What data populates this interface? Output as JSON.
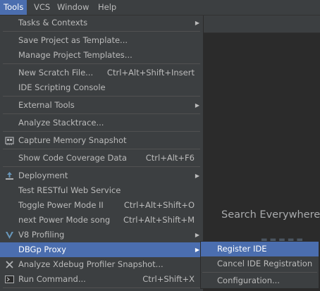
{
  "menubar": [
    {
      "key": "tools",
      "label": "Tools",
      "active": true
    },
    {
      "key": "vcs",
      "label": "VCS",
      "active": false
    },
    {
      "key": "window",
      "label": "Window",
      "active": false
    },
    {
      "key": "help",
      "label": "Help",
      "active": false
    }
  ],
  "tools_menu": {
    "tasks_contexts": {
      "label": "Tasks & Contexts"
    },
    "save_project_as_template": {
      "label": "Save Project as Template..."
    },
    "manage_project_templates": {
      "label": "Manage Project Templates..."
    },
    "new_scratch_file": {
      "label": "New Scratch File...",
      "shortcut": "Ctrl+Alt+Shift+Insert"
    },
    "ide_scripting_console": {
      "label": "IDE Scripting Console"
    },
    "external_tools": {
      "label": "External Tools"
    },
    "analyze_stacktrace": {
      "label": "Analyze Stacktrace..."
    },
    "capture_memory_snapshot": {
      "label": "Capture Memory Snapshot",
      "icon": "memory-snapshot-icon"
    },
    "show_code_coverage": {
      "label": "Show Code Coverage Data",
      "shortcut": "Ctrl+Alt+F6"
    },
    "deployment": {
      "label": "Deployment",
      "icon": "deployment-icon"
    },
    "test_restful": {
      "label": "Test RESTful Web Service"
    },
    "toggle_power_mode": {
      "label": "Toggle Power Mode II",
      "shortcut": "Ctrl+Alt+Shift+O"
    },
    "next_power_mode_song": {
      "label": "next Power Mode song",
      "shortcut": "Ctrl+Alt+Shift+M"
    },
    "v8_profiling": {
      "label": "V8 Profiling",
      "icon": "v8-icon"
    },
    "dbgp_proxy": {
      "label": "DBGp Proxy",
      "selected": true
    },
    "analyze_xdebug": {
      "label": "Analyze Xdebug Profiler Snapshot...",
      "icon": "xdebug-icon"
    },
    "run_command": {
      "label": "Run Command...",
      "shortcut": "Ctrl+Shift+X",
      "icon": "terminal-icon"
    }
  },
  "dbgp_submenu": {
    "register_ide": {
      "label": "Register IDE",
      "selected": true
    },
    "cancel_ide_registration": {
      "label": "Cancel IDE Registration"
    },
    "configuration": {
      "label": "Configuration..."
    }
  },
  "editor": {
    "search_everywhere": "Search Everywhere"
  },
  "colors": {
    "menu_bg": "#3c3f41",
    "selection": "#4b6eaf",
    "text": "#bbbbbb",
    "editor_bg": "#2b2b2b"
  }
}
